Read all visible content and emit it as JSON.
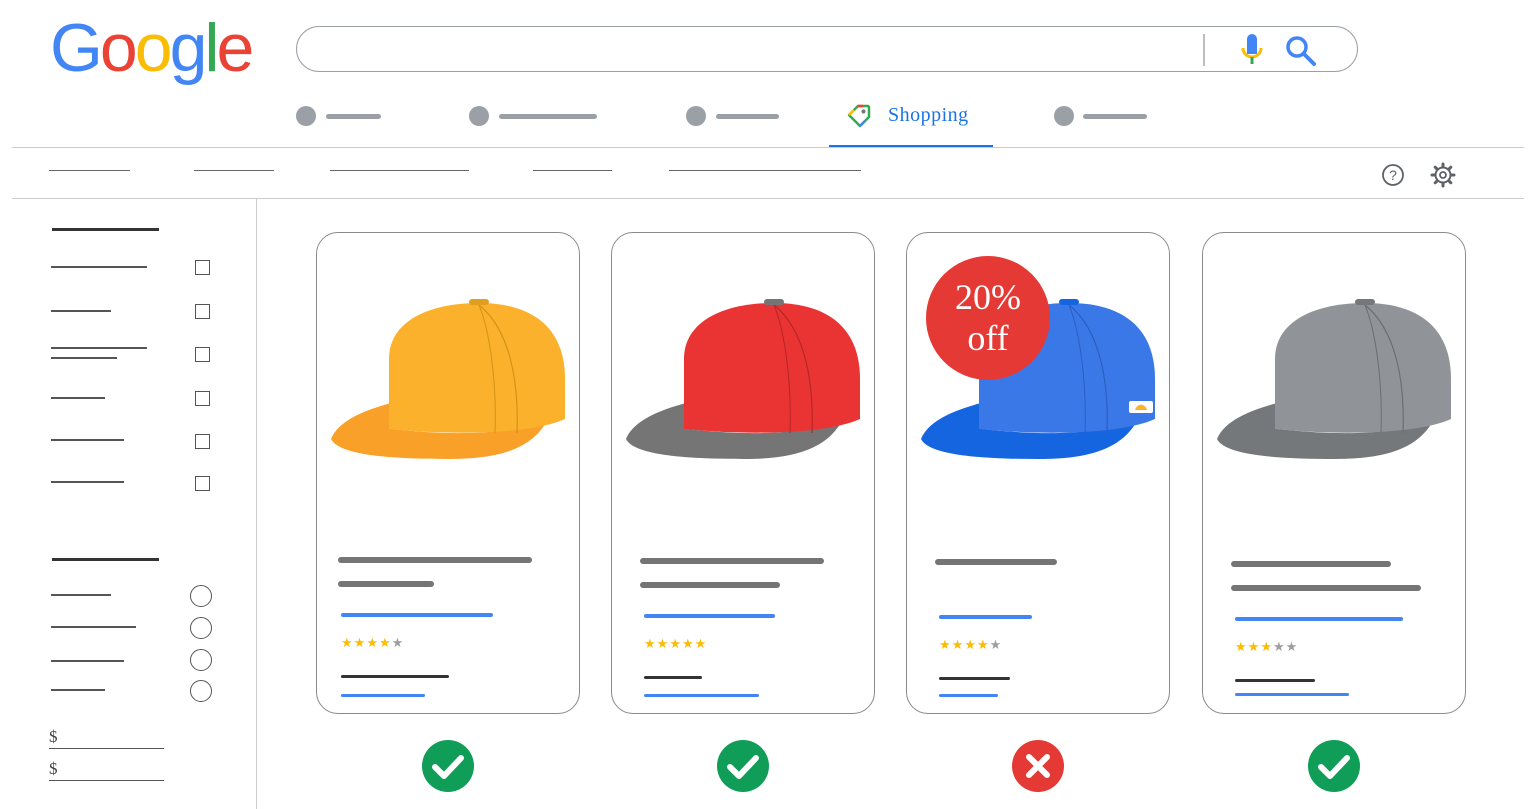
{
  "header": {
    "logo_letters": [
      {
        "char": "G",
        "color": "#4285F4"
      },
      {
        "char": "o",
        "color": "#EA4335"
      },
      {
        "char": "o",
        "color": "#FBBC05"
      },
      {
        "char": "g",
        "color": "#4285F4"
      },
      {
        "char": "l",
        "color": "#34A853"
      },
      {
        "char": "e",
        "color": "#EA4335"
      }
    ],
    "search": {
      "value": "",
      "mic_icon": "mic-icon",
      "search_icon": "search-icon"
    }
  },
  "tabs": {
    "active_label": "Shopping",
    "active_icon": "shopping-tag-icon",
    "accent": "#1a73e8"
  },
  "toolbar": {
    "help_icon": "help-icon",
    "settings_icon": "gear-icon"
  },
  "sidebar": {
    "checkbox_count": 6,
    "radio_count": 4,
    "price_symbol_min": "$",
    "price_symbol_max": "$"
  },
  "products": [
    {
      "color": "#FBB12C",
      "brim": "#F9A028",
      "rating": 4,
      "stars_total": 5,
      "badge": null,
      "status": "approved"
    },
    {
      "color": "#EA3434",
      "brim": "#757575",
      "rating": 5,
      "stars_total": 5,
      "badge": null,
      "status": "approved"
    },
    {
      "color": "#3B78E7",
      "brim": "#1565E0",
      "rating": 4,
      "stars_total": 5,
      "badge": {
        "line1": "20%",
        "line2": "off"
      },
      "status": "rejected"
    },
    {
      "color": "#909498",
      "brim": "#75787b",
      "rating": 3,
      "stars_total": 5,
      "badge": null,
      "status": "approved"
    }
  ],
  "status_colors": {
    "approved": "#0F9D58",
    "rejected": "#E53935"
  }
}
